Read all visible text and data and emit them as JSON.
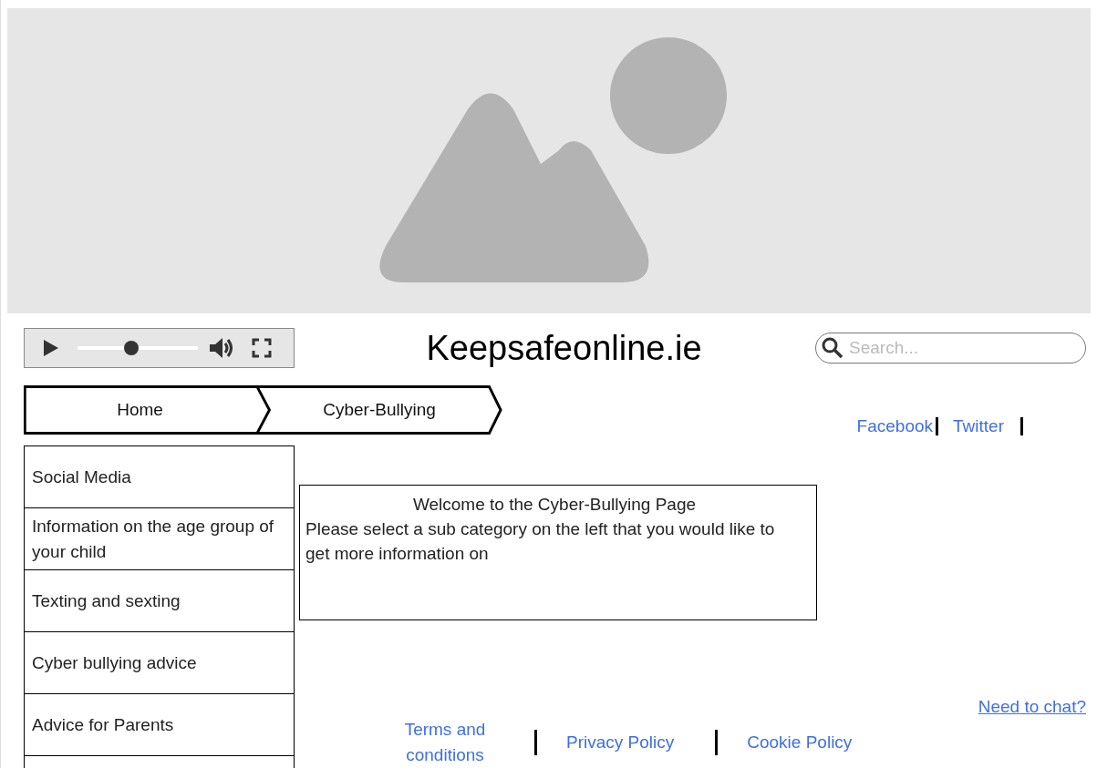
{
  "player": {
    "level": 0.45
  },
  "site_title": "Keepsafeonline.ie",
  "search": {
    "placeholder": "Search..."
  },
  "breadcrumb": [
    "Home",
    "Cyber-Bullying"
  ],
  "social_links": [
    "Facebook",
    "Twitter"
  ],
  "sidebar": {
    "items": [
      "Social Media",
      "Information on the age group of your child",
      "Texting and sexting",
      "Cyber bullying advice",
      "Advice for Parents"
    ]
  },
  "welcome": {
    "heading": "Welcome to the Cyber-Bullying Page",
    "body": "Please select a sub category on the left that you would like to get more information on"
  },
  "chat_link": "Need to chat?",
  "footer_links": [
    "Terms and conditions",
    "Privacy Policy",
    "Cookie Policy"
  ]
}
